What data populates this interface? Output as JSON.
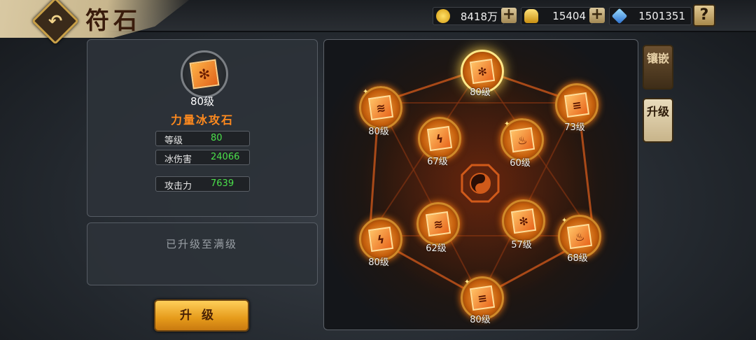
{
  "header": {
    "title": "符石",
    "back_icon": "back-arrow-icon",
    "resources": [
      {
        "icon": "gold-coin-icon",
        "value": "8418万"
      },
      {
        "icon": "gold-ingot-icon",
        "value": "15404"
      },
      {
        "icon": "diamond-icon",
        "value": "1501351"
      }
    ],
    "plus_label": "+",
    "help_label": "?"
  },
  "detail": {
    "level_label": "80级",
    "name": "力量冰攻石",
    "stats": [
      {
        "key": "等级",
        "value": "80"
      },
      {
        "key": "冰伤害",
        "value": "24066"
      },
      {
        "key": "攻击力",
        "value": "7639"
      }
    ],
    "status_text": "已升级至满级",
    "upgrade_button": "升级"
  },
  "tabs": [
    {
      "label": "镶嵌",
      "active": false
    },
    {
      "label": "升级",
      "active": true
    }
  ],
  "stones": [
    {
      "id": "top",
      "icon": "snowflake-icon",
      "level": "80级",
      "selected": true
    },
    {
      "id": "upper-left",
      "icon": "claw-icon",
      "level": "80级",
      "selected": false
    },
    {
      "id": "upper-right",
      "icon": "tornado-icon",
      "level": "73级",
      "selected": false
    },
    {
      "id": "inner-upper-left",
      "icon": "lightning-icon",
      "level": "67级",
      "selected": false
    },
    {
      "id": "inner-upper-right",
      "icon": "fire-icon",
      "level": "60级",
      "selected": false
    },
    {
      "id": "inner-lower-left",
      "icon": "claw-icon",
      "level": "62级",
      "selected": false
    },
    {
      "id": "inner-lower-right",
      "icon": "snowflake-icon",
      "level": "57级",
      "selected": false
    },
    {
      "id": "lower-left",
      "icon": "lightning-icon",
      "level": "80级",
      "selected": false
    },
    {
      "id": "lower-right",
      "icon": "fire-icon",
      "level": "68级",
      "selected": false
    },
    {
      "id": "bottom",
      "icon": "tornado-icon",
      "level": "80级",
      "selected": false
    }
  ],
  "icon_glyphs": {
    "snowflake-icon": "✻",
    "claw-icon": "≋",
    "tornado-icon": "≡",
    "lightning-icon": "ϟ",
    "fire-icon": "♨"
  },
  "colors": {
    "accent": "#ff8a1e",
    "stat_value": "#4be04b",
    "button": "#e59a1a"
  }
}
